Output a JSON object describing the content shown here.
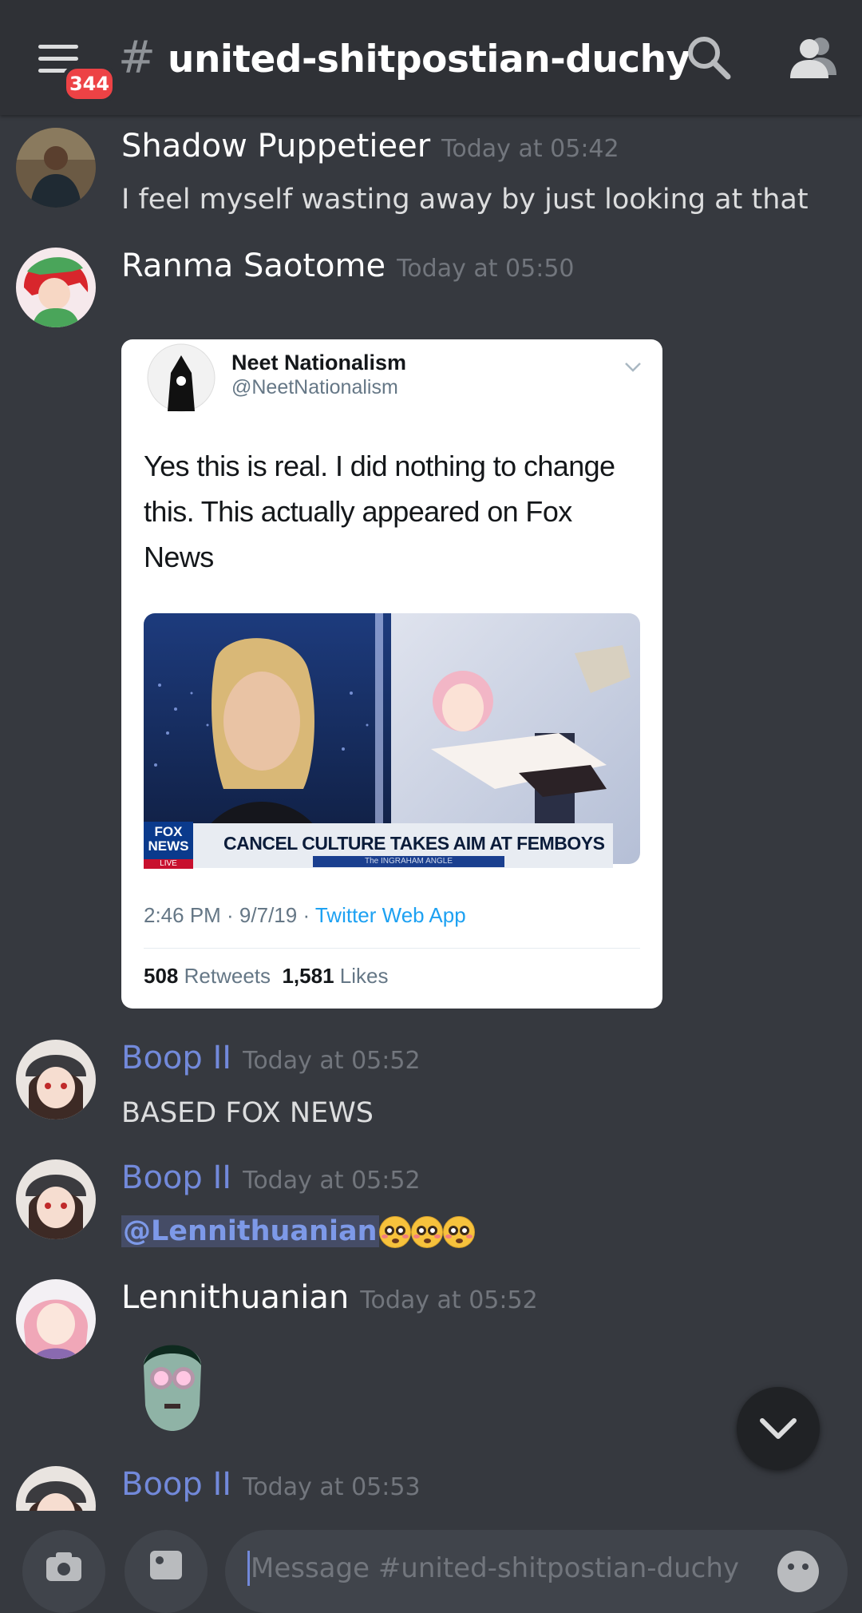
{
  "header": {
    "unread_count": "344",
    "channel_prefix": "#",
    "channel_name": "united-shitpostian-duchy"
  },
  "messages": [
    {
      "author": "Shadow Puppetieer",
      "time": "Today at 05:42",
      "text": "I feel myself wasting away by just looking at that"
    },
    {
      "author": "Ranma Saotome",
      "time": "Today at 05:50",
      "embed": {
        "name": "Neet Nationalism",
        "handle": "@NeetNationalism",
        "text": "Yes this is real. I did nothing to change this. This actually appeared on Fox News",
        "image_caption": "CANCEL CULTURE TAKES AIM AT FEMBOYS",
        "image_logo": "FOX NEWS",
        "image_live": "LIVE",
        "image_subcaption": "The INGRAHAM ANGLE",
        "date": "2:46 PM · 9/7/19 · ",
        "app": "Twitter Web App",
        "retweets_count": "508",
        "retweets_label": "Retweets",
        "likes_count": "1,581",
        "likes_label": "Likes"
      }
    },
    {
      "author": "Boop II",
      "time": "Today at 05:52",
      "text": "BASED FOX NEWS"
    },
    {
      "author": "Boop II",
      "time": "Today at 05:52",
      "mention": "@Lennithuanian",
      "emoji_name": "flushed-face-emoji"
    },
    {
      "author": "Lennithuanian",
      "time": "Today at 05:52",
      "sticker": "custom-face-emoji"
    },
    {
      "author": "Boop II",
      "time": "Today at 05:53"
    }
  ],
  "composer": {
    "placeholder": "Message #united-shitpostian-duchy"
  },
  "colors": {
    "background": "#36393f",
    "header": "#2f3136",
    "badge": "#ed4245",
    "blurple": "#7289da",
    "timestamp": "#72767d"
  }
}
